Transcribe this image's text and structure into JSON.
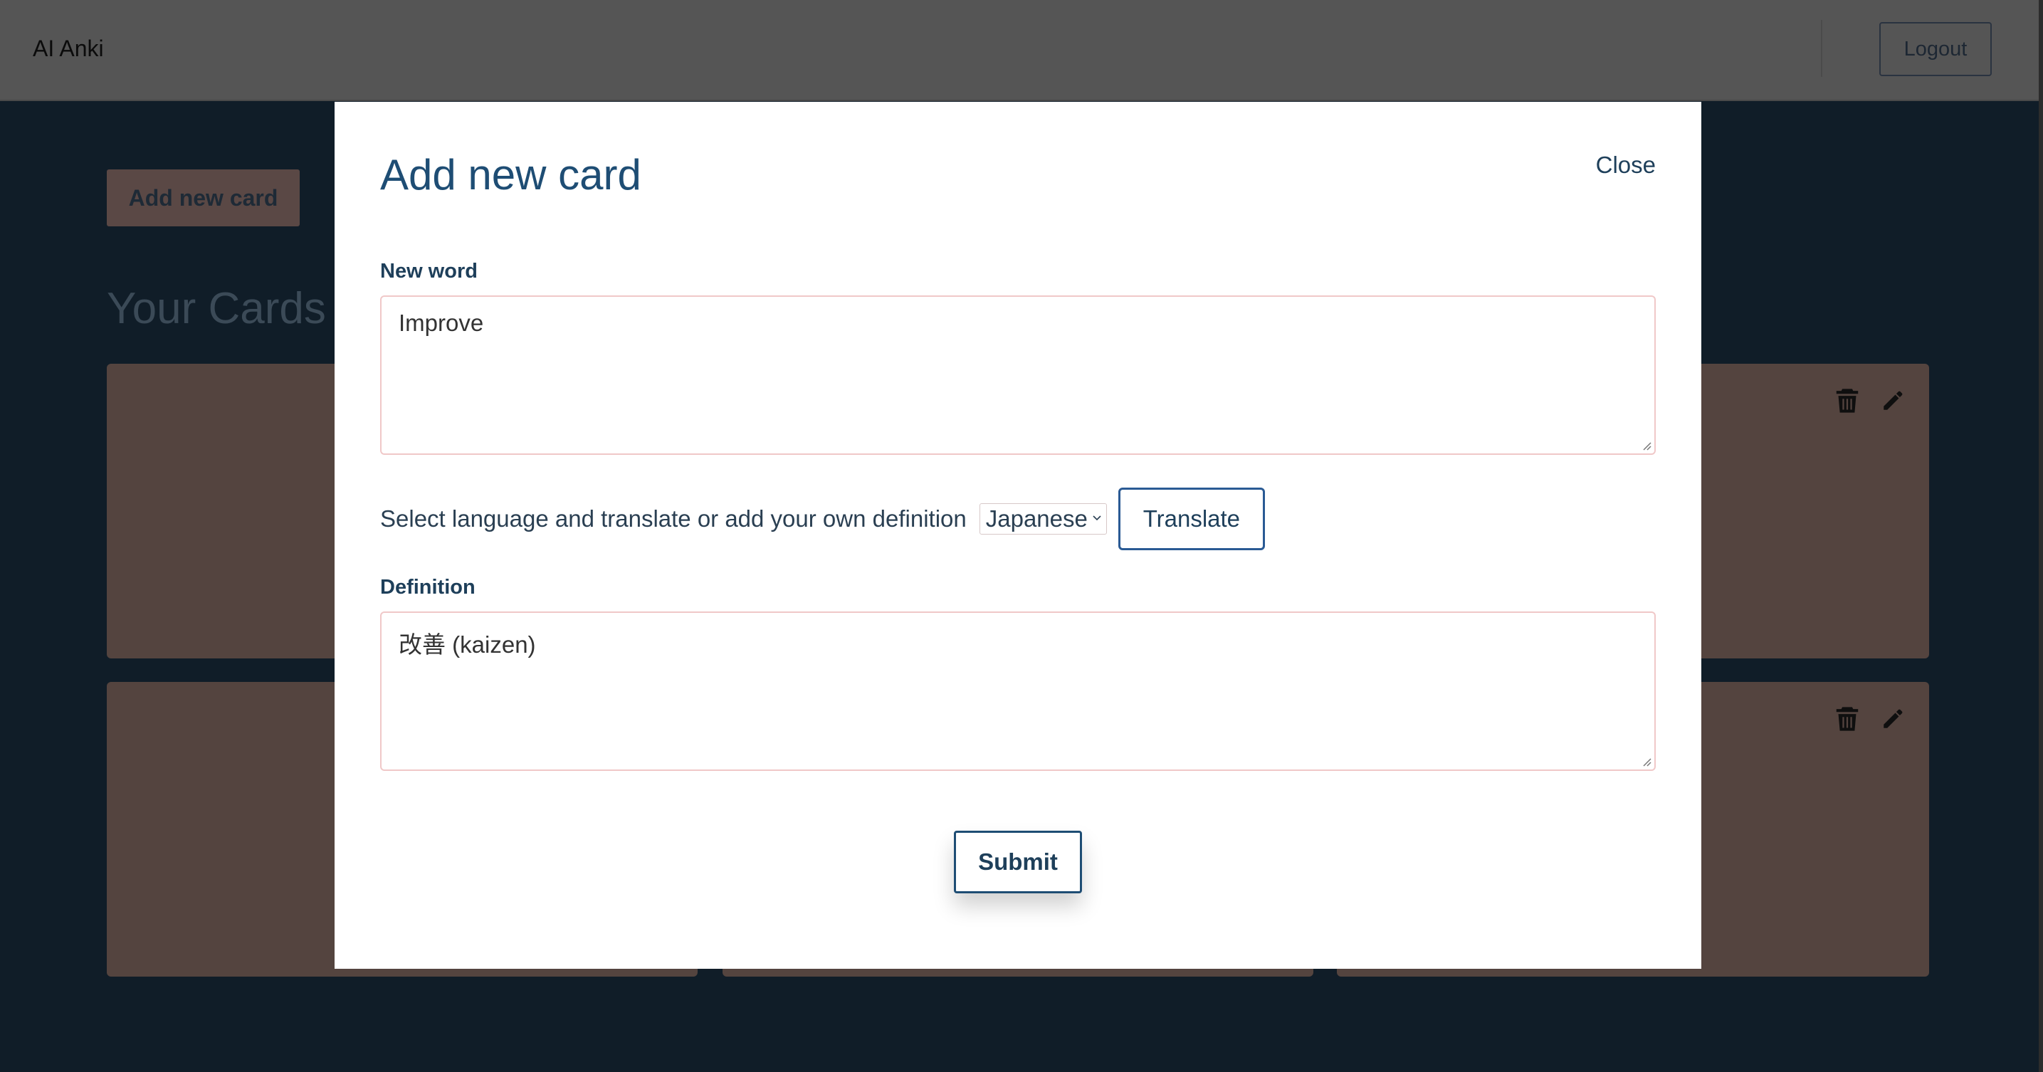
{
  "app": {
    "brand": "AI Anki",
    "logout_label": "Logout",
    "add_card_label": "Add new card",
    "cards_heading": "Your Cards"
  },
  "modal": {
    "title": "Add new card",
    "close_label": "Close",
    "new_word_label": "New word",
    "new_word_value": "Improve",
    "language_prompt": "Select language and translate or add your own definition",
    "language_selected": "Japanese",
    "translate_label": "Translate",
    "definition_label": "Definition",
    "definition_value": "改善 (kaizen)",
    "submit_label": "Submit"
  },
  "icons": [
    "trash-icon",
    "pencil-icon",
    "chevron-down-icon"
  ],
  "colors": {
    "overlay": "#101d28",
    "card": "#54443f",
    "modal_title": "#1e4d74",
    "button_border": "#2a5a94",
    "field_border": "#f0c8c8"
  }
}
